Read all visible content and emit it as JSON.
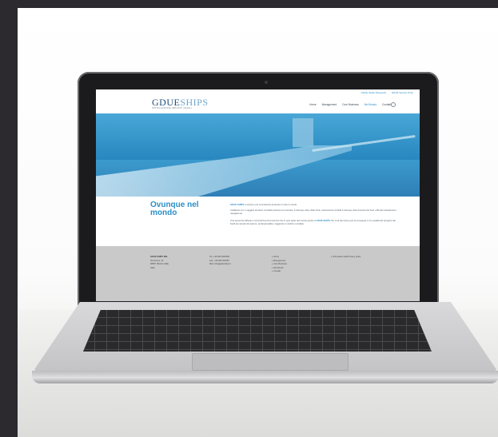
{
  "site": {
    "topbar": [
      "GDUE Sicilia Shipyards",
      "GDUE Service Point"
    ],
    "logo_main": "GDUE",
    "logo_accent": "SHIPS",
    "logo_sub": "INSTALLAZIONE IMPIANTI NAVALI",
    "nav": [
      "Home",
      "Management",
      "Core Business",
      "Nel Mondo",
      "Contatti"
    ],
    "nav_active_index": 3
  },
  "content": {
    "title": "Ovunque nel mondo",
    "p1_strong": "GDUE SHIPS",
    "p1_rest": " è sempre una concretezza presente in tutto il mondo.",
    "p2": "Collabora con i maggiori armatori mondiali presenti sul mercato, in Europa, Asia, Stati Uniti, mantenendo contatti in Europa, Asia America del Sud, offrendo assistenza e navigazione.",
    "p3_a": "Una presenza diffusa e concretizza prima ancora che in ogni parte del mondo grazie a ",
    "p3_strong": "GDUE SHIPS",
    "p3_b": " che cura del tempo per la consegna e con qualità del progetto dai livelli più elevati del settore, professionalità e raggiunto in ambito mondiale."
  },
  "footer": {
    "col1": [
      "GDUE SHIPS SRL",
      "Via Nuova, 10",
      "98057 Milazzo (ME)",
      "Italia"
    ],
    "col2": [
      "Tel: +39 090 0000000",
      "Fax: +39 090 000000",
      "Mail: info@gdueships.it"
    ],
    "links": [
      "Home",
      "Management",
      "Core Business",
      "Nel Mondo",
      "Contatti"
    ],
    "col4": "Informativa sulla Privacy policy"
  },
  "colors": {
    "accent": "#2b8fc7",
    "footer_bg": "#c9c9c9",
    "logo": "#1f4f7c"
  }
}
